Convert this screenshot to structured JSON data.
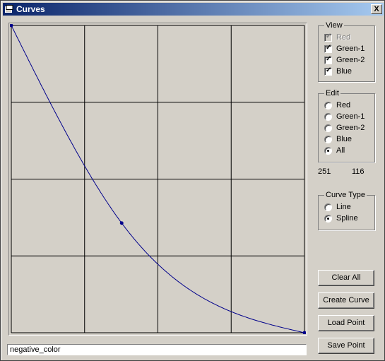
{
  "window": {
    "title": "Curves",
    "close_label": "X"
  },
  "view": {
    "legend": "View",
    "items": [
      {
        "label": "Red",
        "checked": true,
        "disabled": true
      },
      {
        "label": "Green-1",
        "checked": true,
        "disabled": false
      },
      {
        "label": "Green-2",
        "checked": true,
        "disabled": false
      },
      {
        "label": "Blue",
        "checked": true,
        "disabled": false
      }
    ]
  },
  "edit": {
    "legend": "Edit",
    "options": [
      "Red",
      "Green-1",
      "Green-2",
      "Blue",
      "All"
    ],
    "selected": "All"
  },
  "readout": {
    "x": "251",
    "y": "116"
  },
  "curve_type": {
    "legend": "Curve Type",
    "options": [
      "Line",
      "Spline"
    ],
    "selected": "Spline"
  },
  "buttons": {
    "clear_all": "Clear All",
    "create_curve": "Create Curve",
    "load_point": "Load Point",
    "save_point": "Save Point"
  },
  "filename": {
    "value": "negative_color"
  },
  "curve": {
    "color": "#00008b",
    "grid_color": "#000000",
    "grid_divisions": 4,
    "control_points": [
      [
        0,
        255
      ],
      [
        96,
        91
      ],
      [
        255,
        0
      ]
    ]
  }
}
